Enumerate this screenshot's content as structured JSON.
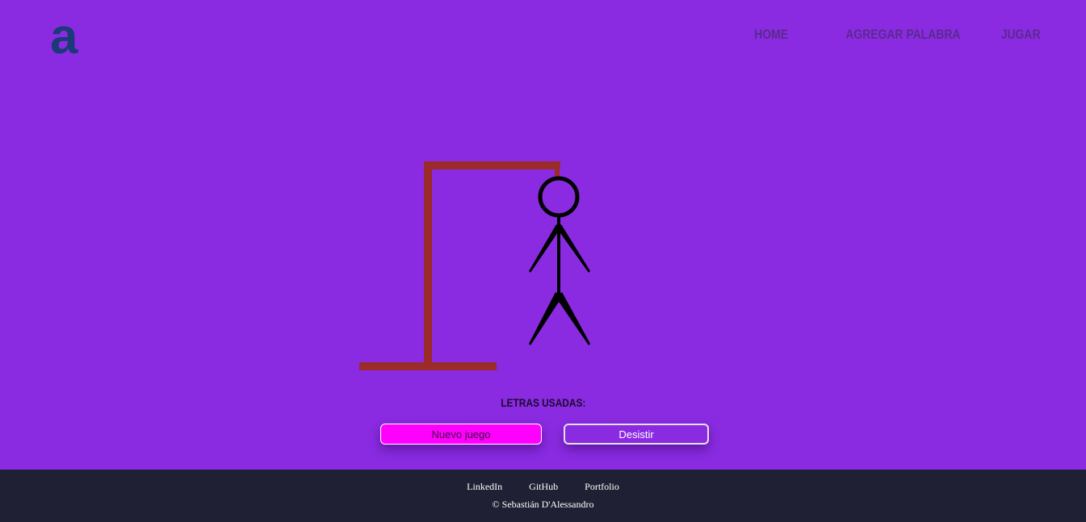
{
  "header": {
    "logo_glyph": "a",
    "logo_color": "#1b3a78",
    "nav": [
      "HOME",
      "AGREGAR PALABRA",
      "JUGAR"
    ]
  },
  "game": {
    "letters_used_label": "LETRAS USADAS:",
    "letters_used": "",
    "gallows_color": "#9b2a2a",
    "figure_color": "#000000"
  },
  "buttons": {
    "new_game": "Nuevo juego",
    "give_up": "Desistir"
  },
  "footer": {
    "links": [
      "LinkedIn",
      "GitHub",
      "Portfolio"
    ],
    "copyright": "© Sebastián D'Alessandro"
  },
  "colors": {
    "background": "#8a2be2",
    "accent": "#ff00ff",
    "footer_bg": "#1f2033"
  }
}
